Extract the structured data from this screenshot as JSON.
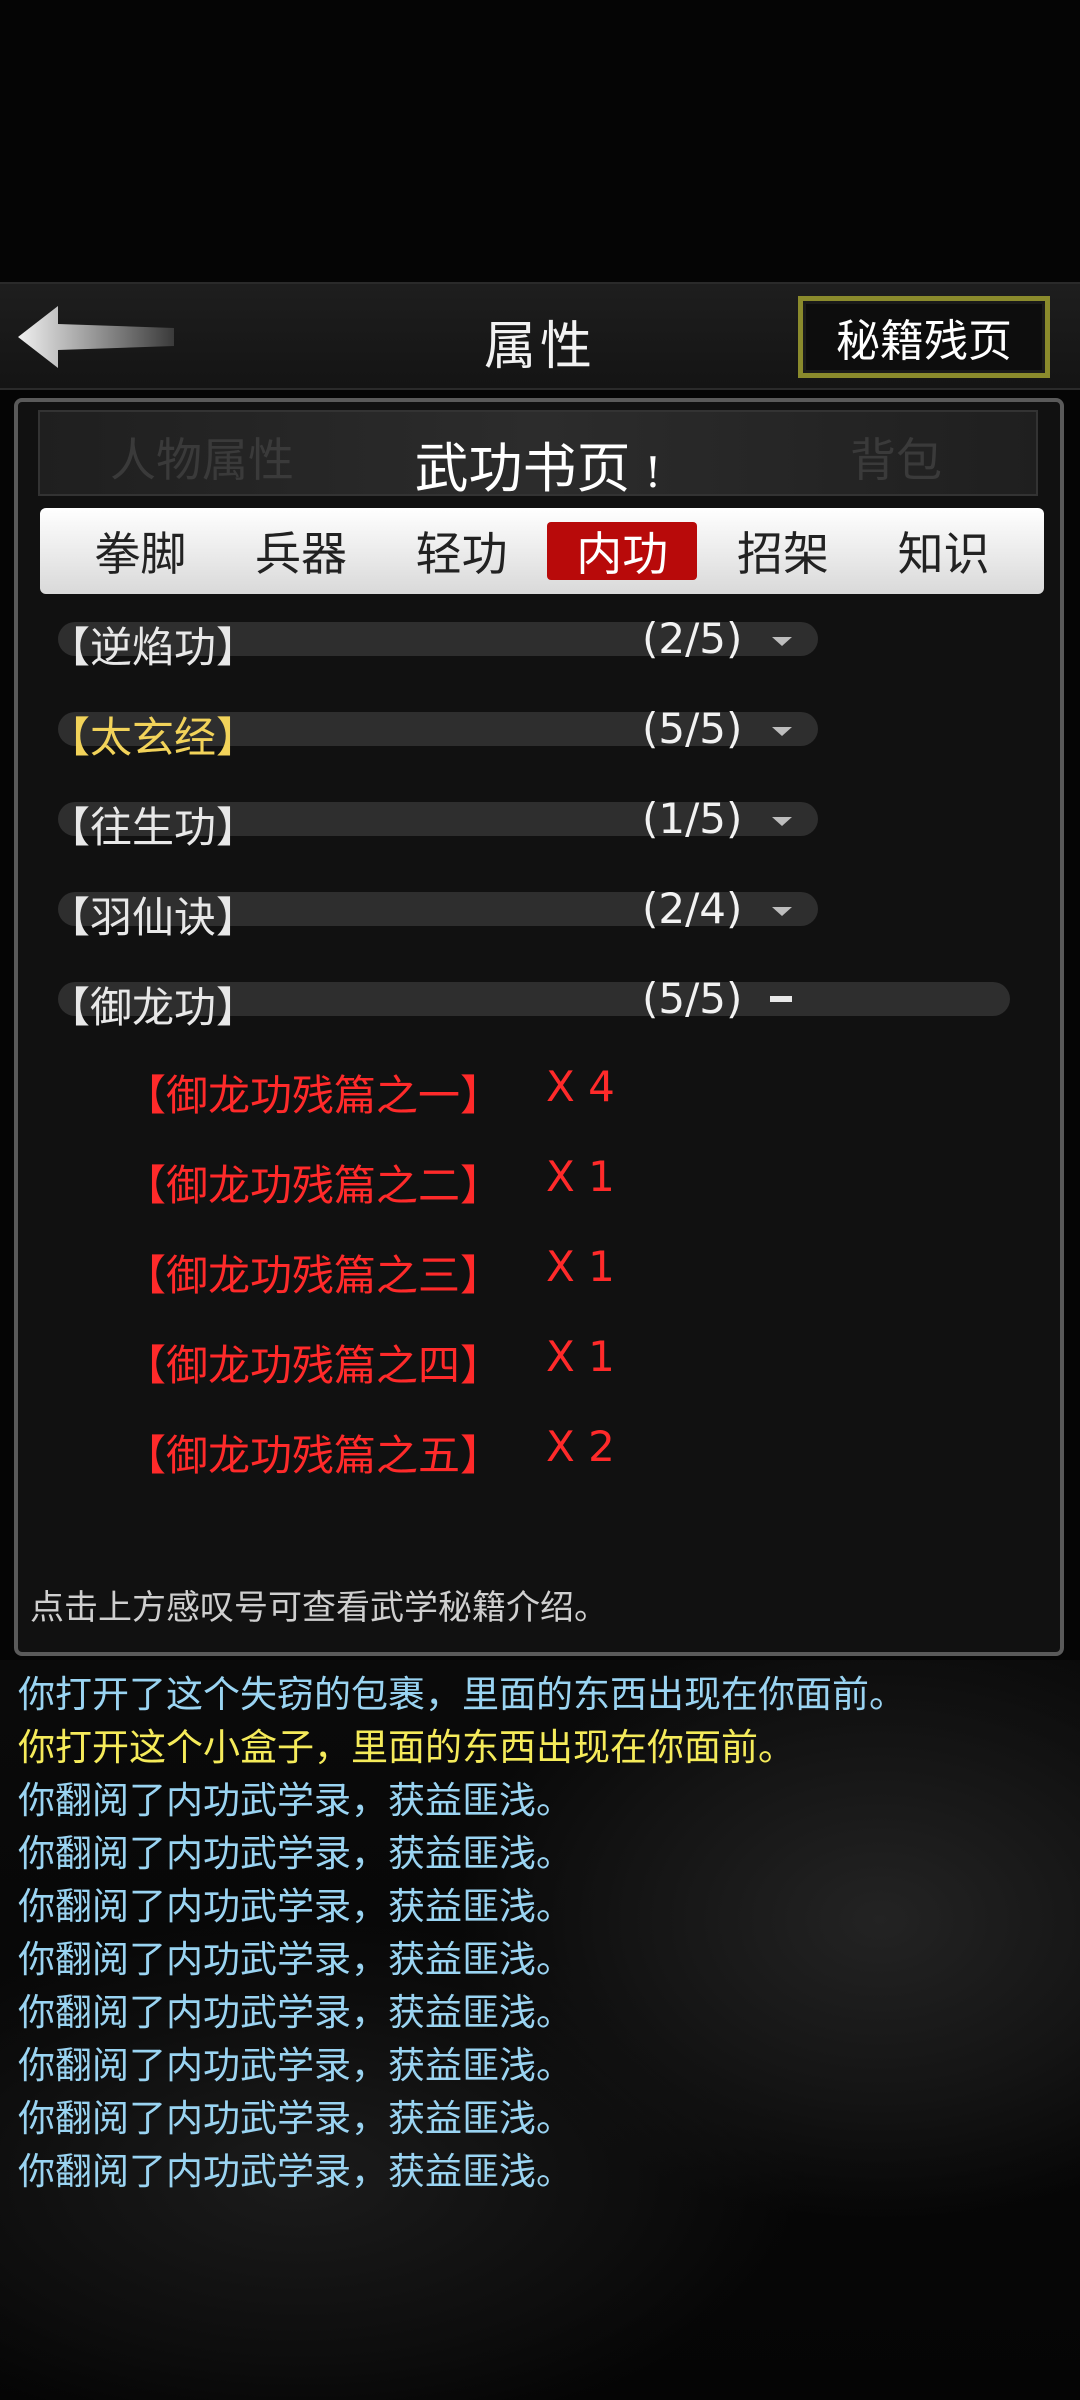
{
  "header": {
    "title": "属性",
    "secret_button": "秘籍残页"
  },
  "panel": {
    "ghost_left": "人物属性",
    "ghost_right": "背包",
    "title": "武功书页",
    "info_icon": "!",
    "tabs": [
      {
        "label": "拳脚",
        "active": false
      },
      {
        "label": "兵器",
        "active": false
      },
      {
        "label": "轻功",
        "active": false
      },
      {
        "label": "内功",
        "active": true
      },
      {
        "label": "招架",
        "active": false
      },
      {
        "label": "知识",
        "active": false
      }
    ],
    "skills": [
      {
        "name": "【逆焰功】",
        "count": "(2/5)",
        "color": "white",
        "expanded": false
      },
      {
        "name": "【太玄经】",
        "count": "(5/5)",
        "color": "gold",
        "expanded": false
      },
      {
        "name": "【往生功】",
        "count": "(1/5)",
        "color": "white",
        "expanded": false
      },
      {
        "name": "【羽仙诀】",
        "count": "(2/4)",
        "color": "white",
        "expanded": false
      },
      {
        "name": "【御龙功】",
        "count": "(5/5)",
        "color": "white",
        "expanded": true
      }
    ],
    "fragments": [
      {
        "name": "【御龙功残篇之一】",
        "qty": "X 4"
      },
      {
        "name": "【御龙功残篇之二】",
        "qty": "X 1"
      },
      {
        "name": "【御龙功残篇之三】",
        "qty": "X 1"
      },
      {
        "name": "【御龙功残篇之四】",
        "qty": "X 1"
      },
      {
        "name": "【御龙功残篇之五】",
        "qty": "X 2"
      }
    ],
    "hint": "点击上方感叹号可查看武学秘籍介绍。"
  },
  "log": [
    {
      "text": "你打开了这个失窃的包裹，里面的东西出现在你面前。",
      "color": "cyan"
    },
    {
      "text": "你打开这个小盒子，里面的东西出现在你面前。",
      "color": "yellow"
    },
    {
      "text": "你翻阅了内功武学录，获益匪浅。",
      "color": "cyan"
    },
    {
      "text": "你翻阅了内功武学录，获益匪浅。",
      "color": "cyan"
    },
    {
      "text": "你翻阅了内功武学录，获益匪浅。",
      "color": "cyan"
    },
    {
      "text": "你翻阅了内功武学录，获益匪浅。",
      "color": "cyan"
    },
    {
      "text": "你翻阅了内功武学录，获益匪浅。",
      "color": "cyan"
    },
    {
      "text": "你翻阅了内功武学录，获益匪浅。",
      "color": "cyan"
    },
    {
      "text": "你翻阅了内功武学录，获益匪浅。",
      "color": "cyan"
    },
    {
      "text": "你翻阅了内功武学录，获益匪浅。",
      "color": "cyan"
    }
  ],
  "colors": {
    "active_tab": "#b80a0a",
    "fragment_red": "#ff2a2a",
    "gold": "#f2d35a",
    "log_cyan": "#9ad4f2",
    "log_yellow": "#f5eb5a"
  }
}
